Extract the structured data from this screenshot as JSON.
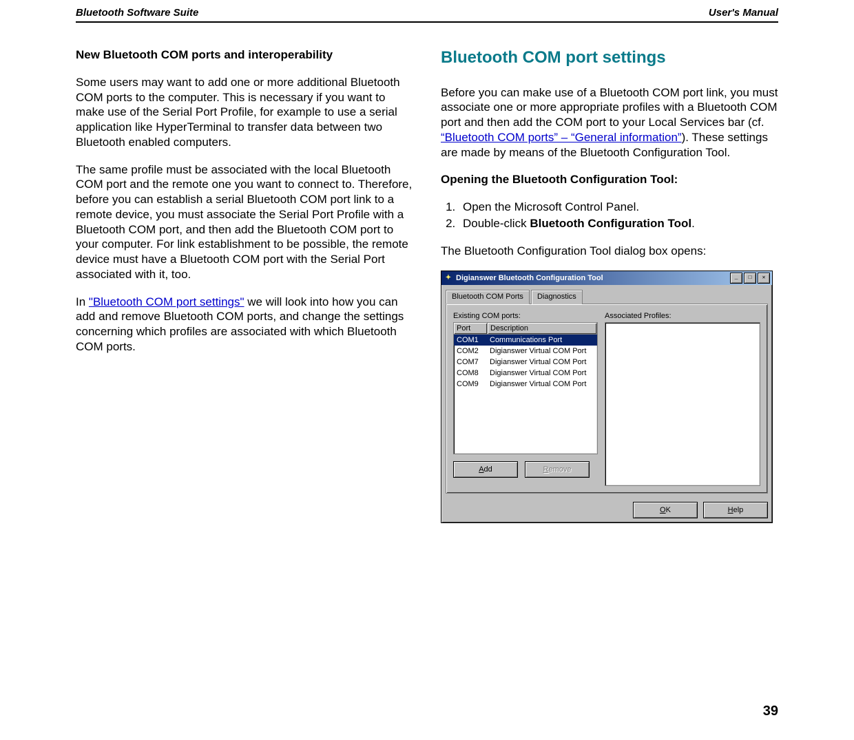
{
  "header": {
    "left": "Bluetooth Software Suite",
    "right": "User's Manual"
  },
  "pagenum": "39",
  "left_column": {
    "subheading": "New Bluetooth COM ports and interoperability",
    "p1": "Some users may want to add one or more additional Bluetooth COM ports to the computer. This is necessary if you want to make use of the Serial Port Profile, for example to use a serial application like HyperTerminal to transfer data between two Bluetooth enabled computers.",
    "p2": "The same profile must be associated with the local Bluetooth COM port and the remote one you want to connect to. Therefore, before you can establish a serial Bluetooth COM port link to a remote device, you must associate the Serial Port Profile with a Bluetooth COM port, and then add the Bluetooth COM port to your computer. For link establishment to be possible, the remote device must have a Bluetooth COM port with the Serial Port associated with it, too.",
    "p3_prefix": "In ",
    "p3_link": "\"Bluetooth COM port settings\"",
    "p3_suffix": " we will look into how you can add and remove Bluetooth COM ports, and change the settings concerning which profiles are associated with which Bluetooth COM ports."
  },
  "right_column": {
    "title": "Bluetooth COM port settings",
    "p1_prefix": "Before you can make use of a Bluetooth COM port link, you must associate one or more appropriate profiles with a Bluetooth COM port and then add the COM port to your Local Services bar (cf. ",
    "p1_link": "“Bluetooth COM ports” – “General information”",
    "p1_suffix": "). These settings are made by means of the Bluetooth Configuration Tool.",
    "open_heading": "Opening the Bluetooth Configuration Tool:",
    "steps": {
      "s1": "Open the Microsoft Control Panel.",
      "s2_prefix": "Double-click ",
      "s2_bold": "Bluetooth Configuration Tool",
      "s2_suffix": "."
    },
    "p2": "The Bluetooth Configuration Tool dialog box opens:"
  },
  "dialog": {
    "title": "Digianswer Bluetooth Configuration Tool",
    "tabs": {
      "t1": "Bluetooth COM Ports",
      "t2": "Diagnostics"
    },
    "labels": {
      "existing": "Existing COM ports:",
      "associated": "Associated Profiles:"
    },
    "head": {
      "port": "Port",
      "desc": "Description"
    },
    "rows": {
      "r0": {
        "port": "COM1",
        "desc": "Communications Port"
      },
      "r1": {
        "port": "COM2",
        "desc": "Digianswer Virtual COM Port"
      },
      "r2": {
        "port": "COM7",
        "desc": "Digianswer Virtual COM Port"
      },
      "r3": {
        "port": "COM8",
        "desc": "Digianswer Virtual COM Port"
      },
      "r4": {
        "port": "COM9",
        "desc": "Digianswer Virtual COM Port"
      }
    },
    "buttons": {
      "add_u": "A",
      "add_rest": "dd",
      "remove_u": "R",
      "remove_rest": "emove",
      "ok_u": "O",
      "ok_rest": "K",
      "help_u": "H",
      "help_rest": "elp"
    }
  }
}
